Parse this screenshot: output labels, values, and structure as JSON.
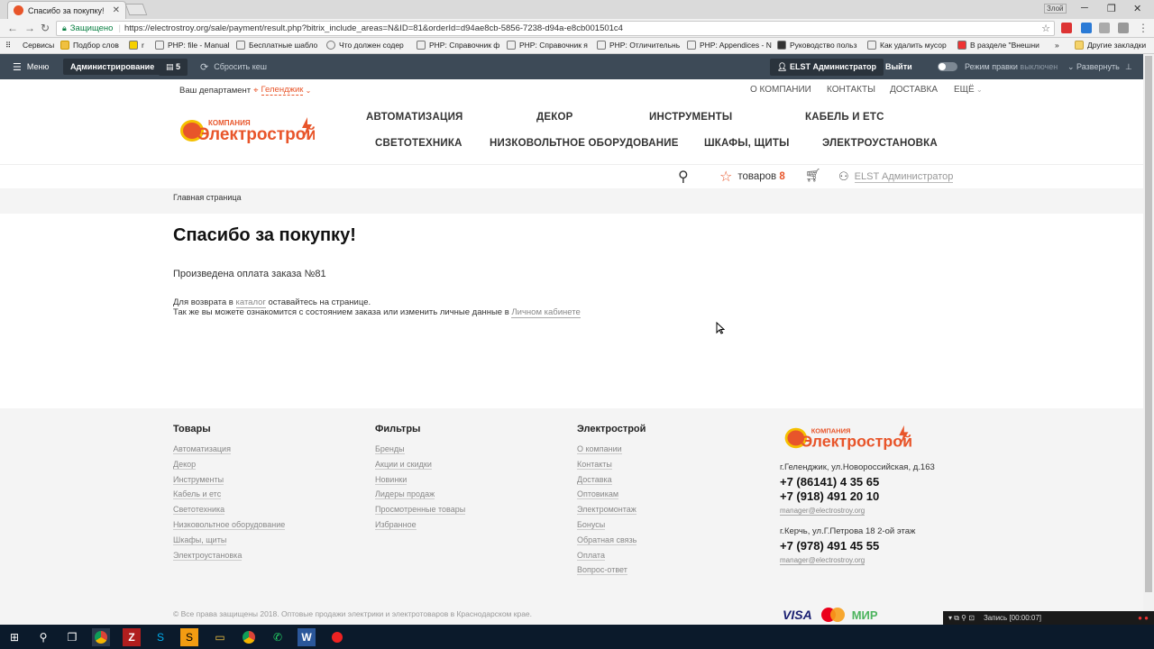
{
  "browser": {
    "tab_title": "Спасибо за покупку!",
    "user_badge": "Злой",
    "secure_label": "Защищено",
    "url": "https://electrostroy.org/sale/payment/result.php?bitrix_include_areas=N&ID=81&orderId=d94ae8cb-5856-7238-d94a-e8cb001501c4"
  },
  "bookmarks": {
    "items": [
      "Сервисы",
      "Подбор слов",
      "r",
      "PHP: file - Manual",
      "Бесплатные шабло",
      "Что должен содер",
      "PHP: Справочник ф",
      "PHP: Справочник я",
      "PHP: Отличительнь",
      "PHP: Appendices - N",
      "Руководство польз",
      "Как удалить мусор",
      "В разделе \"Внешни"
    ],
    "more": "»",
    "other": "Другие закладки"
  },
  "admin_panel": {
    "menu": "Меню",
    "admin": "Администрирование",
    "count": "5",
    "reset_cache": "Сбросить кеш",
    "user": "ELST Администратор",
    "logout": "Выйти",
    "edit_mode_label": "Режим правки",
    "edit_mode_state": "выключен",
    "expand": "Развернуть"
  },
  "header": {
    "dept_label": "Ваш департамент",
    "dept_city": "Геленджик",
    "top_links": [
      "О КОМПАНИИ",
      "КОНТАКТЫ",
      "ДОСТАВКА",
      "ЕЩЁ"
    ],
    "logo_small": "КОМПАНИЯ",
    "logo_big": "Электрострой",
    "menu_row1": [
      "АВТОМАТИЗАЦИЯ",
      "ДЕКОР",
      "ИНСТРУМЕНТЫ",
      "КАБЕЛЬ И ЕТС"
    ],
    "menu_row2": [
      "СВЕТОТЕХНИКА",
      "НИЗКОВОЛЬТНОЕ ОБОРУДОВАНИЕ",
      "ШКАФЫ, ЩИТЫ",
      "ЭЛЕКТРОУСТАНОВКА"
    ],
    "fav_label": "товаров",
    "fav_count": "8",
    "user_link": "ELST Администратор",
    "accent": "#e8552a"
  },
  "breadcrumb": {
    "home": "Главная страница"
  },
  "main": {
    "title": "Спасибо за покупку!",
    "paid": "Произведена оплата заказа №81",
    "return_1a": "Для возврата в",
    "return_link": "каталог",
    "return_1b": "оставайтесь на странице.",
    "return_2a": "Так же вы можете ознакомится с состоянием заказа или изменить личные данные в",
    "return_2link": "Личном кабинете"
  },
  "footer": {
    "col1": {
      "title": "Товары",
      "links": [
        "Автоматизация",
        "Декор",
        "Инструменты",
        "Кабель и етс",
        "Светотехника",
        "Низковольтное оборудование",
        "Шкафы, щиты",
        "Электроустановка"
      ]
    },
    "col2": {
      "title": "Фильтры",
      "links": [
        "Бренды",
        "Акции и скидки",
        "Новинки",
        "Лидеры продаж",
        "Просмотренные товары",
        "Избранное"
      ]
    },
    "col3": {
      "title": "Электрострой",
      "links": [
        "О компании",
        "Контакты",
        "Доставка",
        "Оптовикам",
        "Электромонтаж",
        "Бонусы",
        "Обратная связь",
        "Оплата",
        "Вопрос-ответ"
      ]
    },
    "addr1": "г.Геленджик, ул.Новороссийская, д.163",
    "phone1": "+7 (86141) 4 35 65",
    "phone2": "+7 (918) 491 20 10",
    "mail1": "manager@electrostroy.org",
    "addr2": "г.Керчь, ул.Г.Петрова 18 2-ой этаж",
    "phone3": "+7 (978) 491 45 55",
    "mail2": "manager@electrostroy.org",
    "copyright": "© Все права защищены 2018. Оптовые продажи электрики и электротоваров в Краснодарском крае.",
    "pay_visa": "VISA",
    "pay_mir": "МИР"
  },
  "recorder": {
    "label": "Запись [00:00:07]"
  }
}
